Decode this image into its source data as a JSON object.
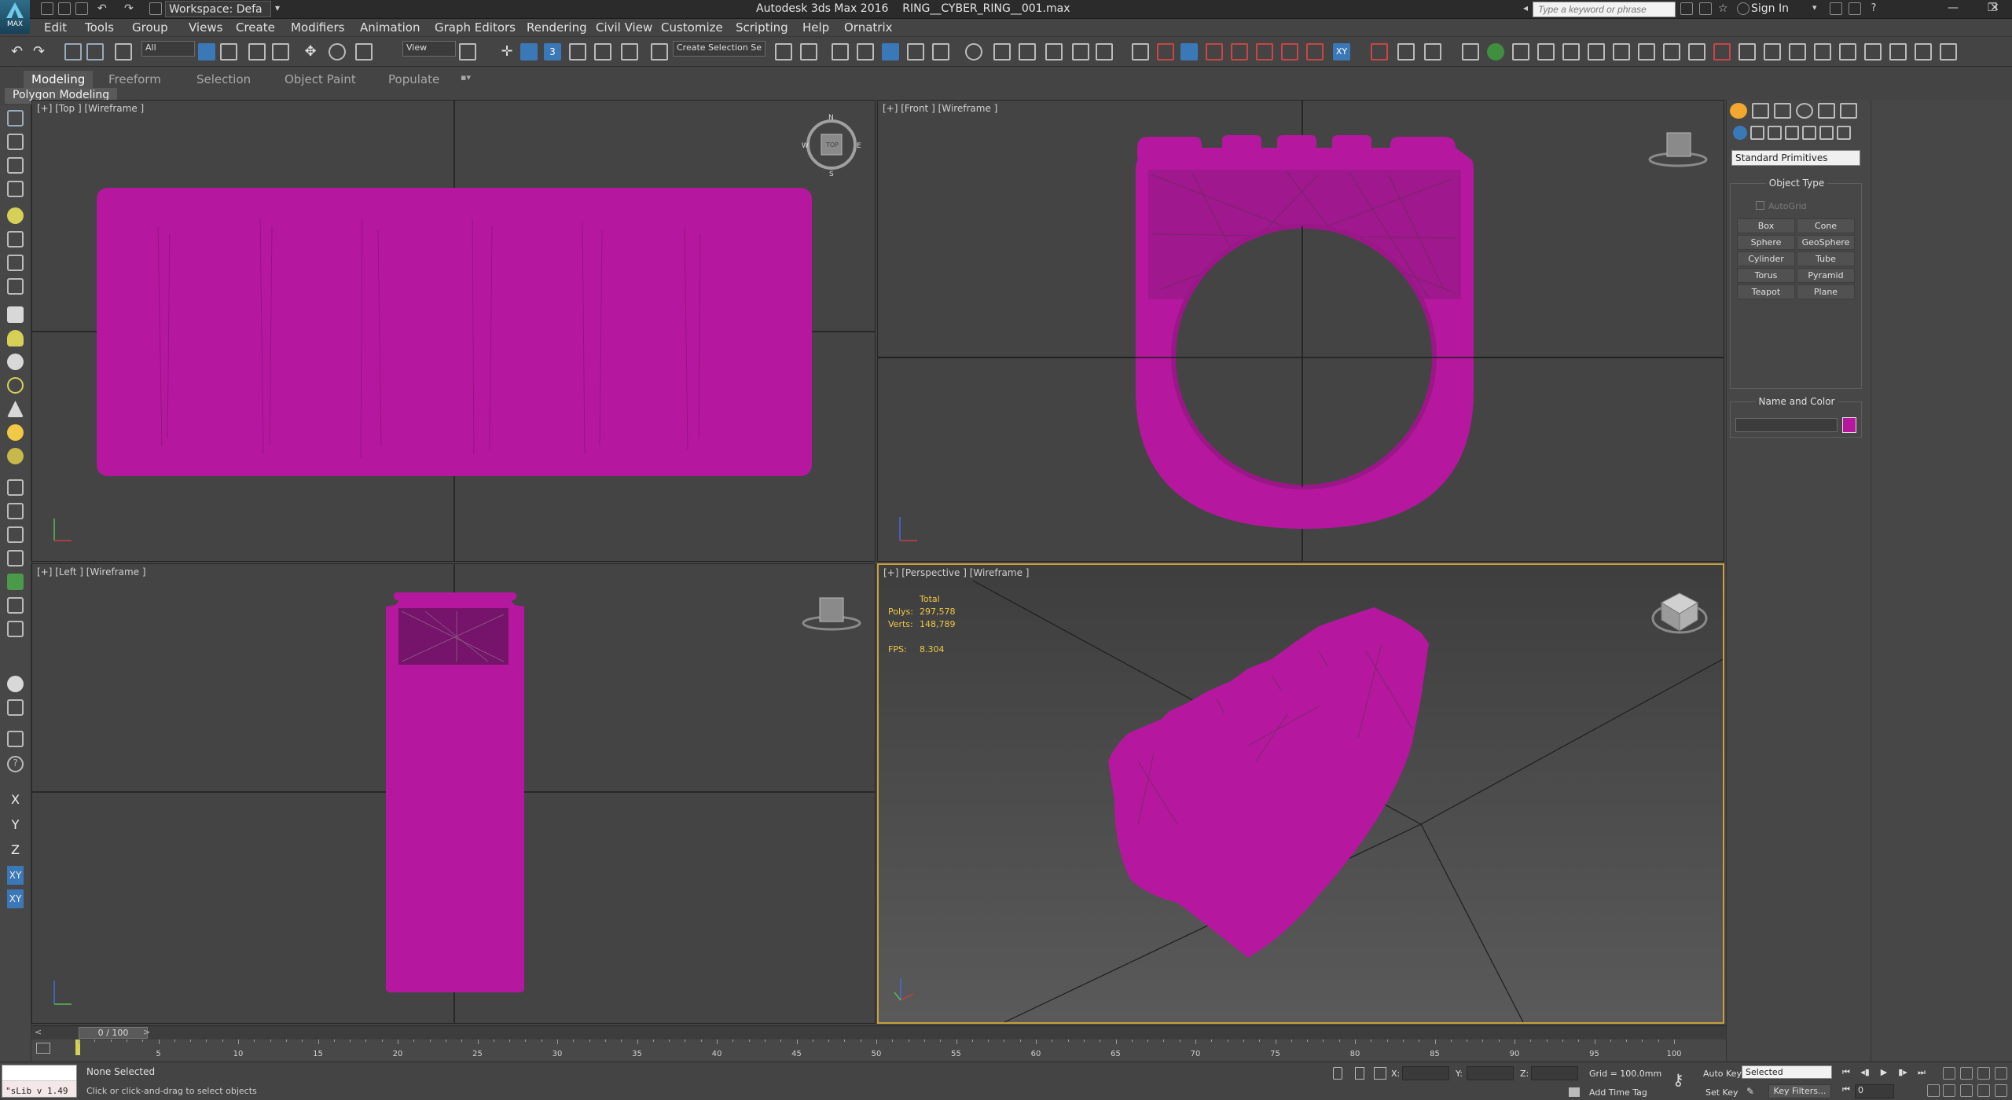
{
  "window": {
    "app_logo_text": "MAX",
    "workspace": "Workspace: Defa",
    "title": "Autodesk 3ds Max 2016    RING__CYBER_RING__001.max",
    "help_search_placeholder": "Type a keyword or phrase",
    "sign_in": "Sign In",
    "minimize": "—",
    "restore": "❐",
    "close": "✕"
  },
  "menu": [
    "Edit",
    "Tools",
    "Group",
    "Views",
    "Create",
    "Modifiers",
    "Animation",
    "Graph Editors",
    "Rendering",
    "Civil View",
    "Customize",
    "Scripting",
    "Help",
    "Ornatrix"
  ],
  "toolbar": {
    "selection_filter": "All",
    "reference_coord": "View",
    "named_selection": "Create Selection Se",
    "snap_toggle": "3",
    "constraint_xy": "XY"
  },
  "ribbon": {
    "tabs": [
      "Modeling",
      "Freeform",
      "Selection",
      "Object Paint",
      "Populate"
    ],
    "active_tab": "Modeling",
    "subpanel": "Polygon Modeling"
  },
  "left_strip": {
    "axis_buttons": [
      "X",
      "Y",
      "Z",
      "XY",
      "XY"
    ]
  },
  "viewports": {
    "top": {
      "label": "[+] [Top ] [Wireframe ]"
    },
    "front": {
      "label": "[+] [Front ] [Wireframe ]"
    },
    "left": {
      "label": "[+] [Left ] [Wireframe ]"
    },
    "perspective": {
      "label": "[+] [Perspective ] [Wireframe ]",
      "stats": {
        "header": "Total",
        "polys_label": "Polys:",
        "polys_value": "297,578",
        "verts_label": "Verts:",
        "verts_value": "148,789",
        "fps_label": "FPS:",
        "fps_value": "8.304"
      }
    },
    "viewcube_top_face": "TOP",
    "compass_n": "N",
    "compass_w": "W",
    "compass_e": "E",
    "compass_s": "S",
    "ring_color": "#b5189e"
  },
  "command_panel": {
    "category": "Standard Primitives",
    "object_type_title": "Object Type",
    "autogrid": "AutoGrid",
    "primitives": [
      "Box",
      "Cone",
      "Sphere",
      "GeoSphere",
      "Cylinder",
      "Tube",
      "Torus",
      "Pyramid",
      "Teapot",
      "Plane"
    ],
    "name_and_color_title": "Name and Color",
    "object_color": "#b5189e"
  },
  "timeline": {
    "slider": "0 / 100",
    "ticks": [
      "0",
      "5",
      "10",
      "15",
      "20",
      "25",
      "30",
      "35",
      "40",
      "45",
      "50",
      "55",
      "60",
      "65",
      "70",
      "75",
      "80",
      "85",
      "90",
      "95",
      "100"
    ]
  },
  "status": {
    "maxscript": "\"sLib v 1.49",
    "selection": "None Selected",
    "prompt": "Click or click-and-drag to select objects",
    "x_label": "X:",
    "y_label": "Y:",
    "z_label": "Z:",
    "grid": "Grid = 100.0mm",
    "add_time_tag": "Add Time Tag",
    "auto_key": "Auto Key",
    "set_key": "Set Key",
    "key_mode": "Selected",
    "key_filters": "Key Filters...",
    "current_frame": "0"
  }
}
